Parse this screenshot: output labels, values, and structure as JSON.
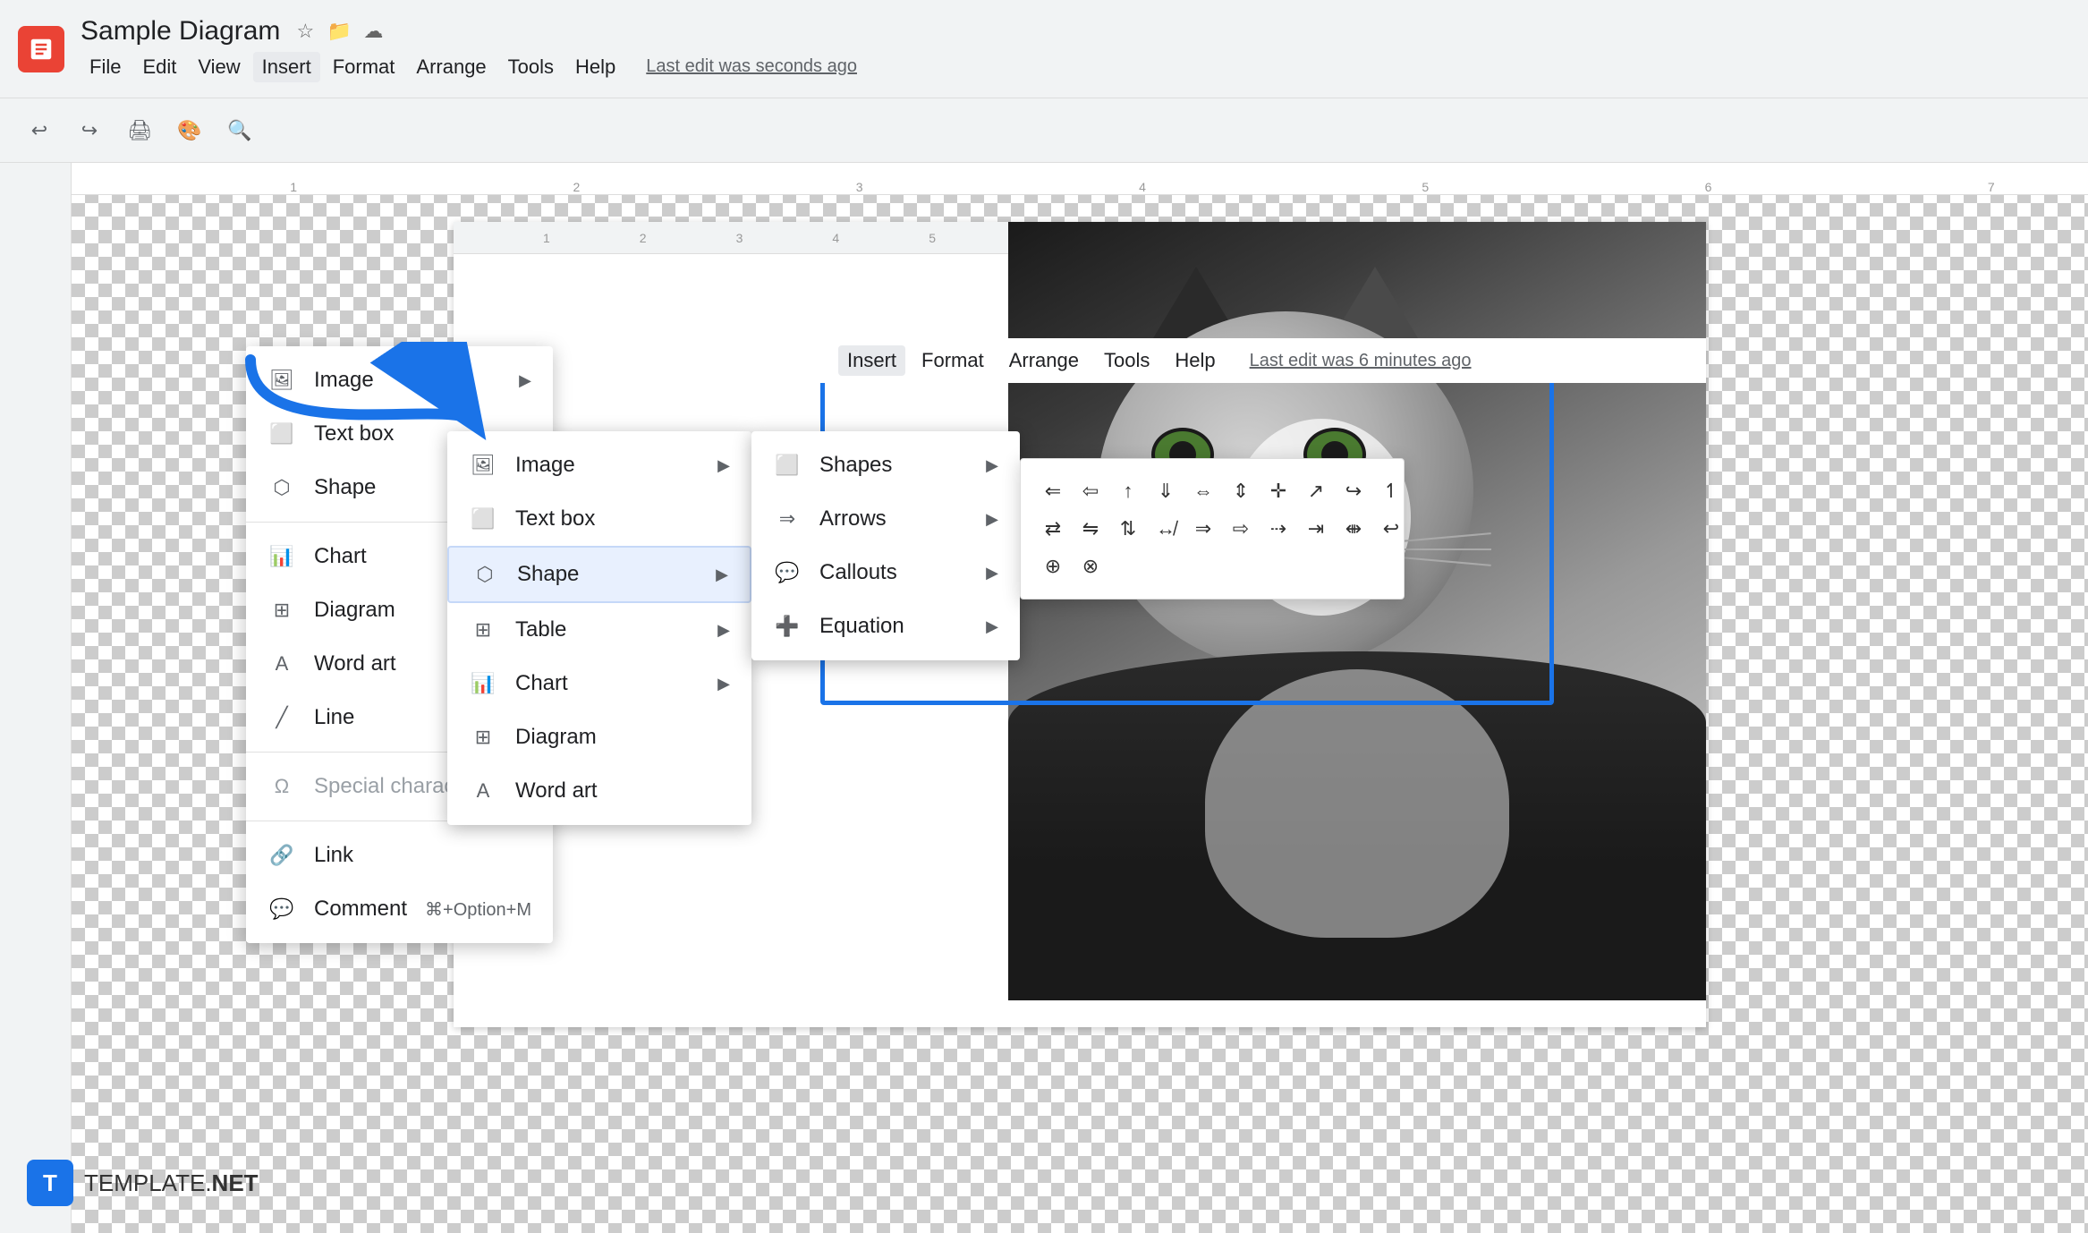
{
  "app": {
    "icon_label": "Slides icon",
    "title": "Sample Diagram",
    "last_edit_chrome": "Last edit was seconds ago",
    "last_edit_doc": "Last edit was 6 minutes ago"
  },
  "menu_bar_chrome": {
    "items": [
      "File",
      "Edit",
      "View",
      "Insert",
      "Format",
      "Arrange",
      "Tools",
      "Help"
    ]
  },
  "menu_bar_doc": {
    "items": [
      "Insert",
      "Format",
      "Arrange",
      "Tools",
      "Help"
    ]
  },
  "toolbar": {
    "undo_label": "↩",
    "redo_label": "↪",
    "print_label": "🖨",
    "paintformat_label": "🎨",
    "zoom_label": "🔍"
  },
  "insert_menu_bg": {
    "items": [
      {
        "label": "Image",
        "icon": "image",
        "has_arrow": true
      },
      {
        "label": "Text box",
        "icon": "textbox",
        "has_arrow": false
      },
      {
        "label": "Shape",
        "icon": "shape",
        "has_arrow": false,
        "highlighted": false
      },
      {
        "label": "Chart",
        "icon": "chart",
        "has_arrow": false
      },
      {
        "label": "Diagram",
        "icon": "diagram",
        "has_arrow": false
      },
      {
        "label": "Word art",
        "icon": "wordart",
        "has_arrow": false
      },
      {
        "label": "Line",
        "icon": "line",
        "has_arrow": false
      }
    ],
    "separator_after": [
      2,
      6
    ],
    "extra_items": [
      {
        "label": "Special characters",
        "icon": "special",
        "disabled": true
      },
      {
        "label": "Link",
        "icon": "link",
        "disabled": false
      },
      {
        "label": "Comment",
        "icon": "comment",
        "shortcut": "⌘+Option+M"
      }
    ]
  },
  "insert_menu_fg": {
    "items": [
      {
        "label": "Image",
        "icon": "image",
        "has_arrow": true
      },
      {
        "label": "Text box",
        "icon": "textbox",
        "has_arrow": false
      },
      {
        "label": "Shape",
        "icon": "shape",
        "has_arrow": true,
        "highlighted": true
      },
      {
        "label": "Table",
        "icon": "table",
        "has_arrow": true
      },
      {
        "label": "Chart",
        "icon": "chart",
        "has_arrow": true
      },
      {
        "label": "Diagram",
        "icon": "diagram",
        "has_arrow": false
      },
      {
        "label": "Word art",
        "icon": "wordart",
        "has_arrow": false
      }
    ]
  },
  "shapes_submenu": {
    "items": [
      {
        "label": "Shapes",
        "has_arrow": true
      },
      {
        "label": "Arrows",
        "has_arrow": true,
        "highlighted": false
      },
      {
        "label": "Callouts",
        "has_arrow": true
      },
      {
        "label": "Equation",
        "has_arrow": true
      }
    ]
  },
  "arrows_panel": {
    "symbols": [
      "⇐",
      "⇦",
      "↑",
      "⇓",
      "⇔",
      "⇕",
      "✛",
      "⇧",
      "↪",
      "↿",
      "↙",
      "⇄",
      "⇅",
      "⇃",
      "↮",
      "⇒",
      "⇨",
      "⇢",
      "⇥",
      "⇼",
      "⇽",
      "⇾",
      "⊕",
      "⊗"
    ]
  },
  "branding": {
    "icon_letter": "T",
    "text_plain": "TEMPLATE.",
    "text_bold": "NET"
  }
}
